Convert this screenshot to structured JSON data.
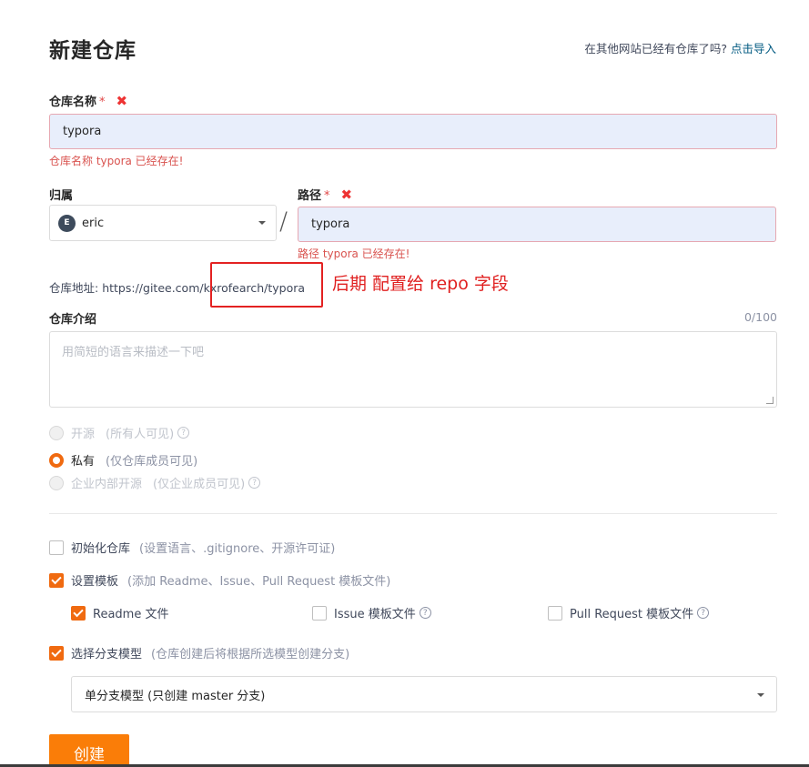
{
  "header": {
    "title": "新建仓库",
    "import_question": "在其他网站已经有仓库了吗?",
    "import_link": "点击导入"
  },
  "repo_name": {
    "label": "仓库名称",
    "required_mark": "*",
    "error_mark": "✖",
    "value": "typora",
    "error": "仓库名称 typora 已经存在!"
  },
  "owner": {
    "label": "归属",
    "avatar_letter": "E",
    "value": "eric"
  },
  "path": {
    "label": "路径",
    "required_mark": "*",
    "error_mark": "✖",
    "value": "typora",
    "error": "路径 typora 已经存在!",
    "separator": "/"
  },
  "address": {
    "label": "仓库地址:",
    "prefix": "https://gitee.com/",
    "suffix": "kxrofearch/typora"
  },
  "annotation": "后期 配置给 repo 字段",
  "description": {
    "label": "仓库介绍",
    "counter": "0/100",
    "placeholder": "用简短的语言来描述一下吧"
  },
  "visibility": [
    {
      "label": "开源",
      "hint": "(所有人可见)",
      "checked": false,
      "disabled": true,
      "help": "?"
    },
    {
      "label": "私有",
      "hint": "(仅仓库成员可见)",
      "checked": true,
      "disabled": false
    },
    {
      "label": "企业内部开源",
      "hint": "(仅企业成员可见)",
      "checked": false,
      "disabled": true,
      "help": "?"
    }
  ],
  "init_repo": {
    "label": "初始化仓库",
    "hint": "(设置语言、.gitignore、开源许可证)",
    "checked": false
  },
  "template": {
    "label": "设置模板",
    "hint": "(添加 Readme、Issue、Pull Request 模板文件)",
    "checked": true
  },
  "template_items": [
    {
      "label": "Readme 文件",
      "checked": true
    },
    {
      "label": "Issue 模板文件",
      "checked": false,
      "help": "?"
    },
    {
      "label": "Pull Request 模板文件",
      "checked": false,
      "help": "?"
    }
  ],
  "branch_model": {
    "label": "选择分支模型",
    "hint": "(仓库创建后将根据所选模型创建分支)",
    "checked": true,
    "value": "单分支模型 (只创建 master 分支)"
  },
  "create_button": "创建",
  "colors": {
    "accent": "#f06a10",
    "error": "#d9534f",
    "link": "#005980",
    "annotation": "#e02020"
  }
}
